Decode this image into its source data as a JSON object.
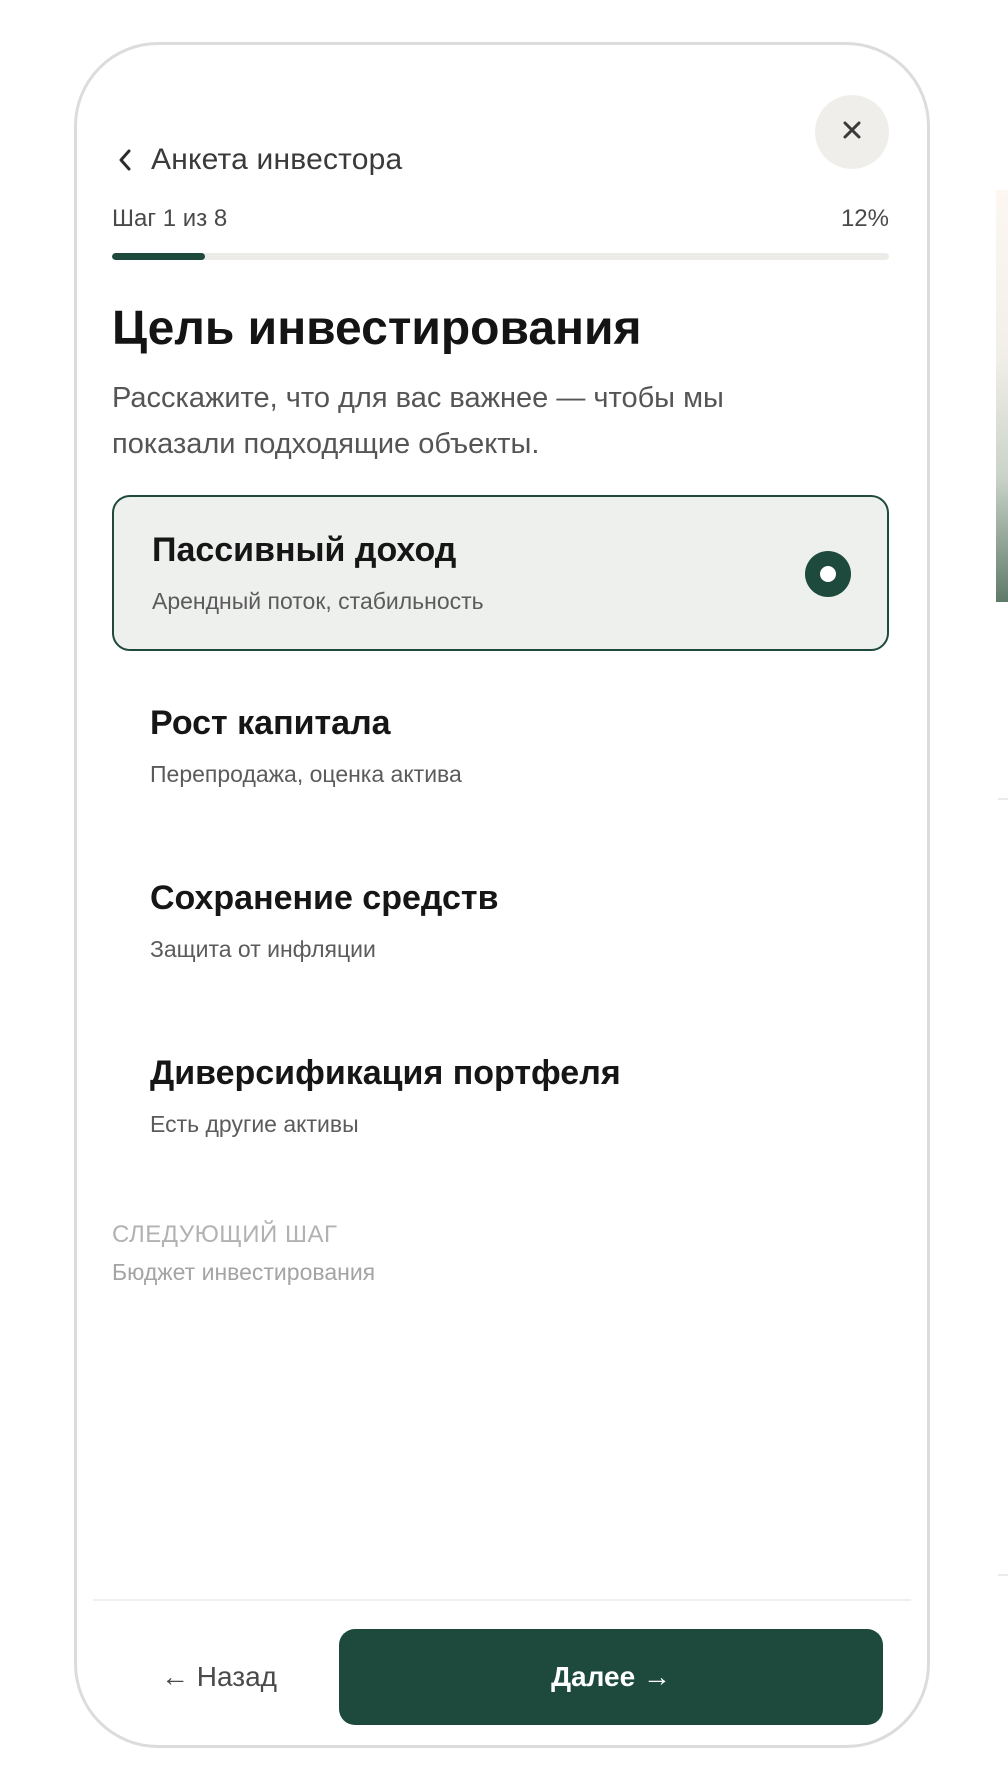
{
  "header": {
    "title": "Анкета инвестора",
    "back_icon": "chevron-left-icon",
    "close_icon": "close-icon"
  },
  "progress": {
    "step_text": "Шаг 1 из 8",
    "percent_text": "12%",
    "value": 0.12
  },
  "page": {
    "title": "Цель инвестирования",
    "subtitle": "Расскажите, что для вас важнее — чтобы мы показали подходящие объекты."
  },
  "options": [
    {
      "title": "Пассивный доход",
      "description": "Арендный поток, стабильность",
      "selected": true
    },
    {
      "title": "Рост капитала",
      "description": "Перепродажа, оценка актива",
      "selected": false
    },
    {
      "title": "Сохранение средств",
      "description": "Защита от инфляции",
      "selected": false
    },
    {
      "title": "Диверсификация портфеля",
      "description": "Есть другие активы",
      "selected": false
    }
  ],
  "next_step": {
    "label": "СЛЕДУЮЩИЙ ШАГ",
    "value": "Бюджет инвестирования"
  },
  "footer": {
    "back_label": "← Назад",
    "next_label": "Далее →"
  },
  "colors": {
    "accent": "#1d4a3d",
    "selected_bg": "#eef0ee",
    "track": "#ecebe7",
    "close_bg": "#efeeea"
  }
}
